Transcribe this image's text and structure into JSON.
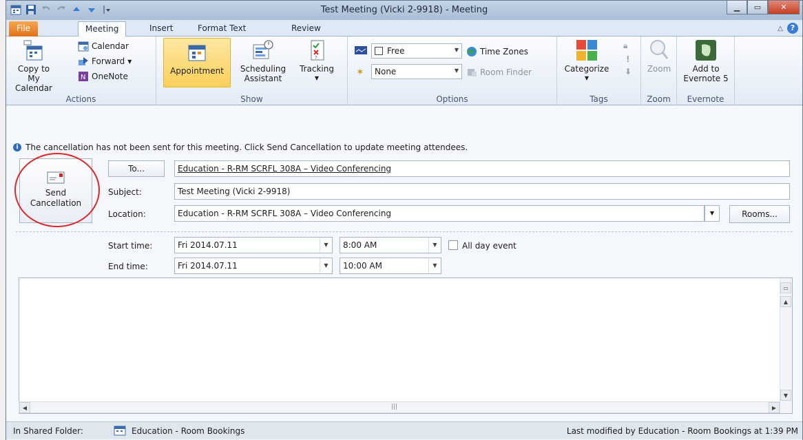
{
  "window": {
    "title": "Test Meeting (Vicki 2-9918)  -  Meeting"
  },
  "tabs": [
    {
      "label": "File"
    },
    {
      "label": "Meeting"
    },
    {
      "label": "Insert"
    },
    {
      "label": "Format Text"
    },
    {
      "label": "Review"
    }
  ],
  "ribbon": {
    "actions": {
      "group_label": "Actions",
      "copy_line1": "Copy to My",
      "copy_line2": "Calendar",
      "calendar": "Calendar",
      "forward": "Forward",
      "onenote": "OneNote"
    },
    "show": {
      "group_label": "Show",
      "appointment": "Appointment",
      "scheduling_line1": "Scheduling",
      "scheduling_line2": "Assistant",
      "tracking": "Tracking"
    },
    "options": {
      "group_label": "Options",
      "show_as": "Free",
      "reminder": "None",
      "time_zones": "Time Zones",
      "room_finder": "Room Finder"
    },
    "tags": {
      "group_label": "Tags",
      "categorize": "Categorize"
    },
    "zoom": {
      "group_label": "Zoom",
      "zoom": "Zoom"
    },
    "evernote": {
      "group_label": "Evernote",
      "line1": "Add to",
      "line2": "Evernote 5"
    }
  },
  "info": {
    "message": "The cancellation has not been sent for this meeting. Click Send Cancellation to update meeting attendees."
  },
  "form": {
    "send_line1": "Send",
    "send_line2": "Cancellation",
    "to_button": "To...",
    "to_value": "Education - R-RM SCRFL 308A – Video Conferencing",
    "subject_label": "Subject:",
    "subject_value": "Test Meeting (Vicki 2-9918)",
    "location_label": "Location:",
    "location_value": "Education - R-RM SCRFL 308A – Video Conferencing",
    "rooms_button": "Rooms...",
    "start_label": "Start time:",
    "start_date": "Fri 2014.07.11",
    "start_time": "8:00 AM",
    "all_day": "All day event",
    "end_label": "End time:",
    "end_date": "Fri 2014.07.11",
    "end_time": "10:00 AM"
  },
  "status": {
    "folder_label": "In Shared Folder:",
    "folder_name": "Education - Room Bookings",
    "modified": "Last modified by Education - Room Bookings at 1:39 PM"
  }
}
